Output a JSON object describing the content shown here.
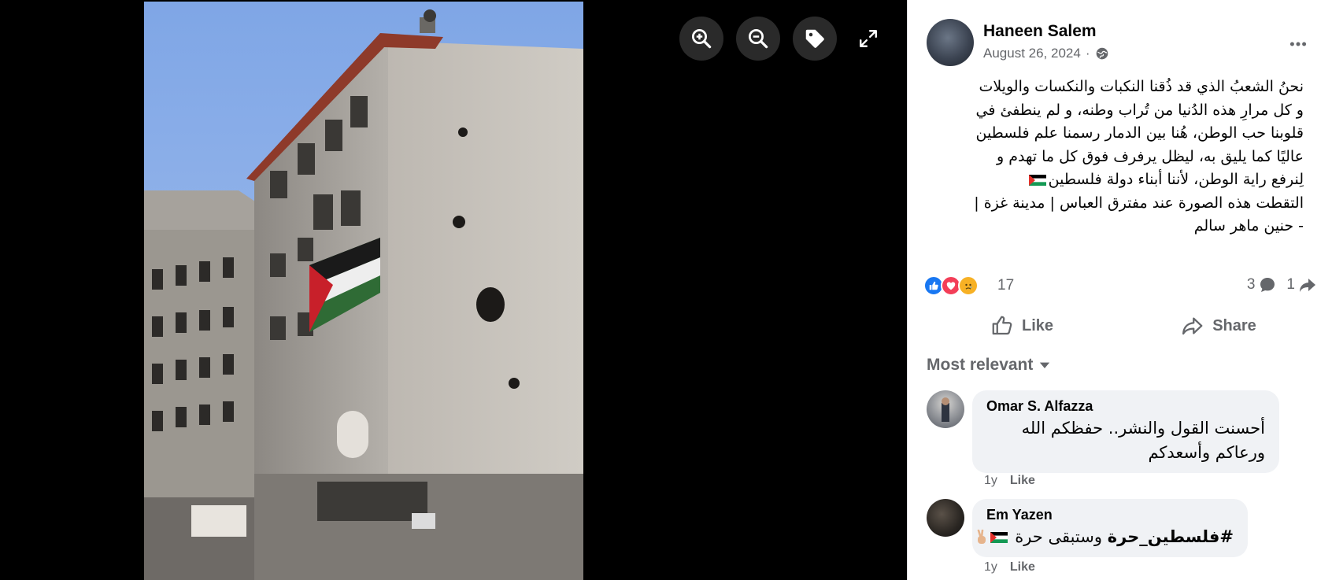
{
  "viewer": {
    "tools": [
      {
        "icon": "zoom-in-icon"
      },
      {
        "icon": "zoom-out-icon"
      },
      {
        "icon": "tag-icon"
      },
      {
        "icon": "fullscreen-icon"
      }
    ]
  },
  "post": {
    "author": "Haneen Salem",
    "date": "August 26, 2024",
    "separator": "·",
    "audience_icon": "globe-icon",
    "text_lines": [
      "نحنُ الشعبُ الذي قد ذُقنا النكبات والنكسات والويلات",
      "و كل مرارِ هذه الدُنيا من تُراب وطنه، و لم ينطفئ في",
      "قلوبنا حب الوطن، هُنا بين الدمار رسمنا علم فلسطين",
      "عاليًا كما يليق به، ليظل يرفرف فوق كل ما تهدم و",
      "لِنرفع راية الوطن، لأننا أبناء دولة فلسطين",
      "التقطت هذه الصورة عند مفترق العباس | مدينة غزة |",
      "- حنين ماهر سالم"
    ],
    "reactions": [
      "like",
      "love",
      "sad"
    ],
    "reaction_count": "17",
    "comment_count": "3",
    "share_count": "1",
    "actions": {
      "like": "Like",
      "share": "Share"
    }
  },
  "comments_sort": "Most relevant",
  "comments": [
    {
      "name": "Omar S. Alfazza",
      "lines": [
        "أحسنت القول والنشر.. حفظكم الله",
        "ورعاكم وأسعدكم"
      ],
      "time": "1y",
      "like": "Like"
    },
    {
      "name": "Em Yazen",
      "hashtag": "#فلسطين_حرة",
      "text": "وستبقى حرة",
      "time": "1y",
      "like": "Like"
    }
  ],
  "colors": {
    "like_blue": "#1877f2",
    "love_red": "#f33e58",
    "sad_yellow": "#f7b125",
    "text_secondary": "#65676b",
    "bubble_bg": "#f0f2f5"
  }
}
